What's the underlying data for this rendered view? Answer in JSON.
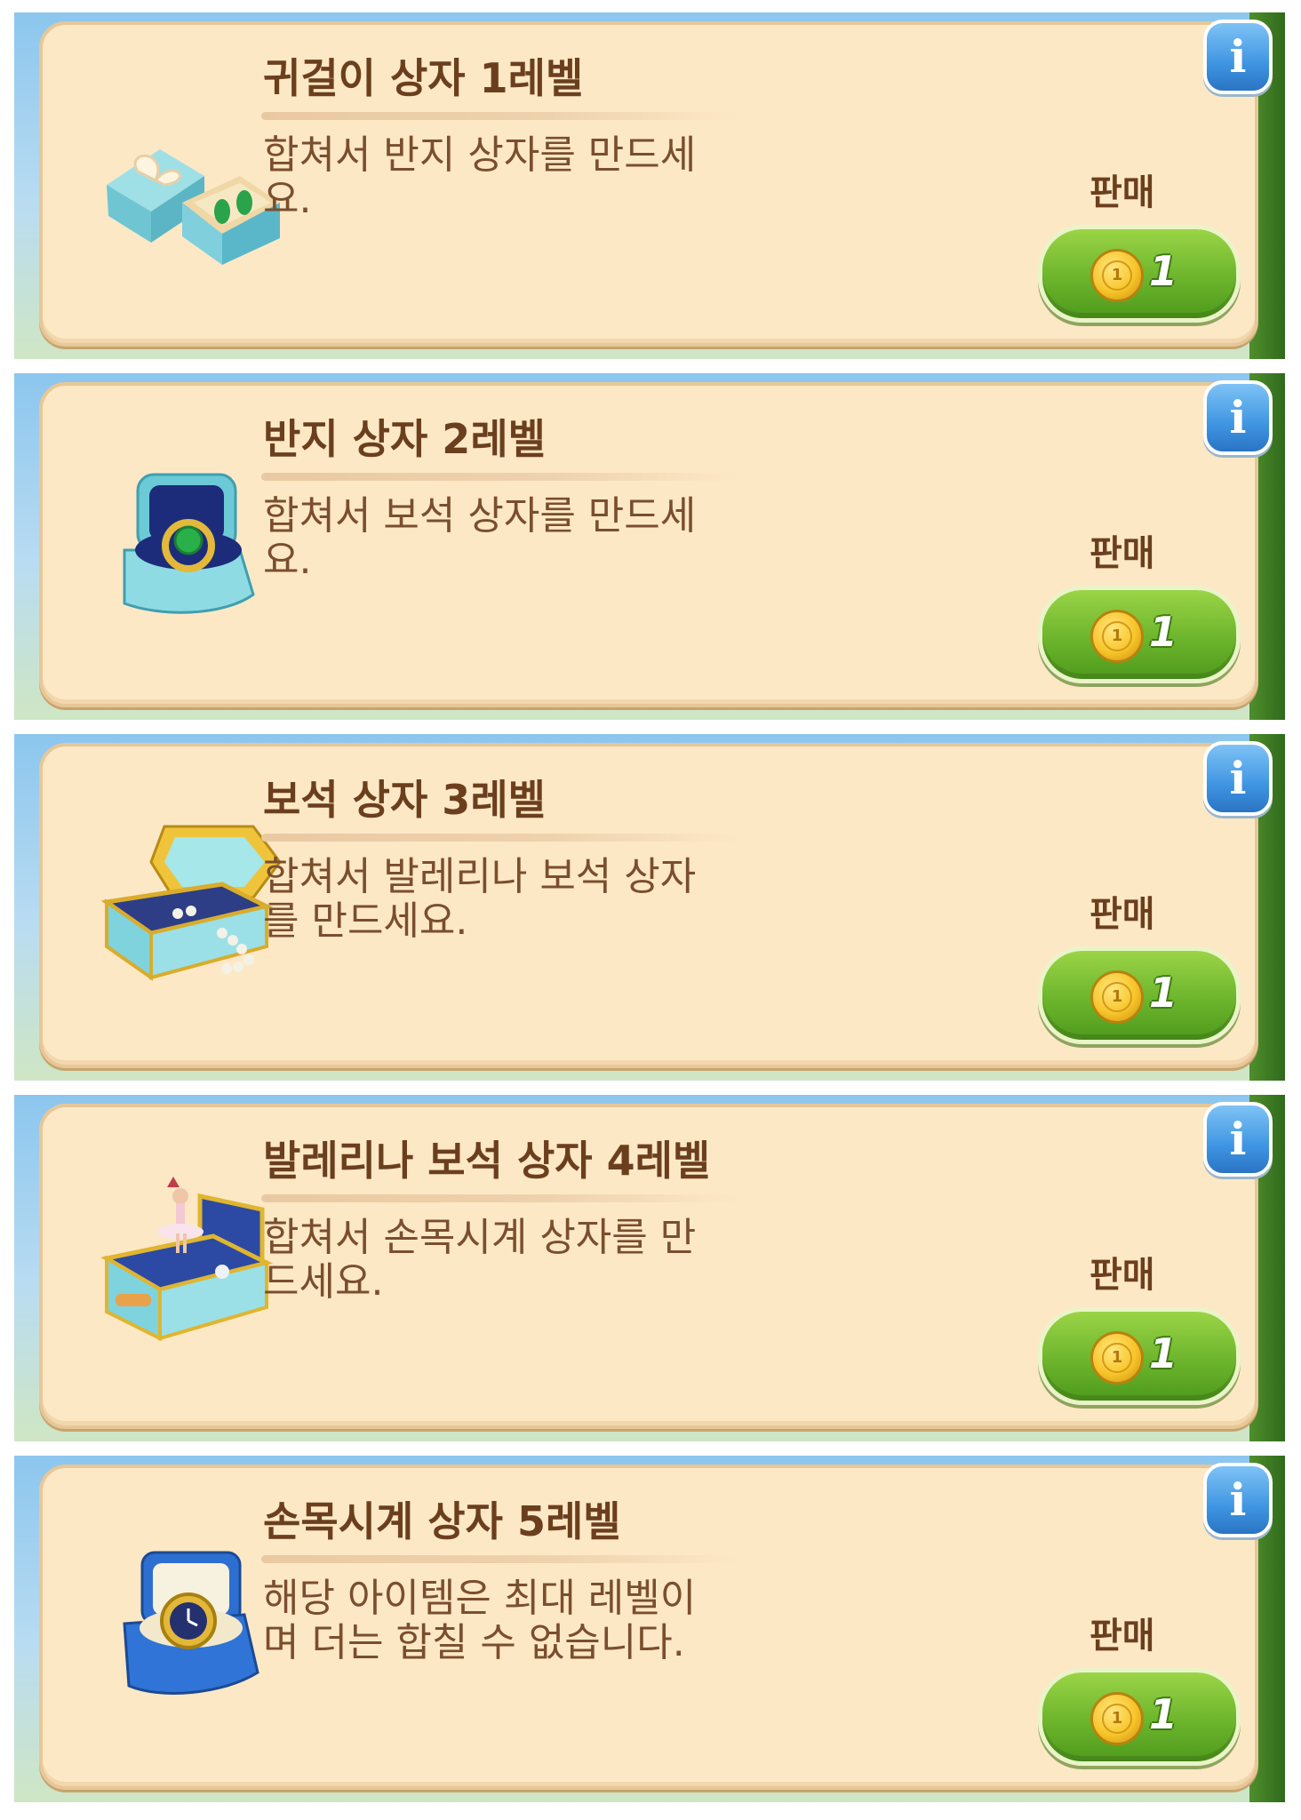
{
  "items": [
    {
      "title": "귀걸이 상자 1레벨",
      "description": "합쳐서 반지 상자를 만드세요.",
      "sell_label": "판매",
      "price": "1",
      "coin_mark": "1",
      "icon": "earring-box-icon",
      "info_label": "i"
    },
    {
      "title": "반지 상자 2레벨",
      "description": "합쳐서 보석 상자를 만드세요.",
      "sell_label": "판매",
      "price": "1",
      "coin_mark": "1",
      "icon": "ring-box-icon",
      "info_label": "i"
    },
    {
      "title": "보석 상자 3레벨",
      "description": "합쳐서 발레리나 보석 상자를 만드세요.",
      "sell_label": "판매",
      "price": "1",
      "coin_mark": "1",
      "icon": "jewel-box-icon",
      "info_label": "i"
    },
    {
      "title": "발레리나 보석 상자 4레벨",
      "description": "합쳐서 손목시계 상자를 만드세요.",
      "sell_label": "판매",
      "price": "1",
      "coin_mark": "1",
      "icon": "ballerina-music-box-icon",
      "info_label": "i"
    },
    {
      "title": "손목시계 상자 5레벨",
      "description": "해당 아이템은 최대 레벨이며 더는 합칠 수 없습니다.",
      "sell_label": "판매",
      "price": "1",
      "coin_mark": "1",
      "icon": "watch-box-icon",
      "info_label": "i"
    }
  ],
  "colors": {
    "card_bg": "#fde8c6",
    "title_text": "#6b3f1e",
    "sell_button": "#6cb52c",
    "info_button": "#3f95e2"
  }
}
